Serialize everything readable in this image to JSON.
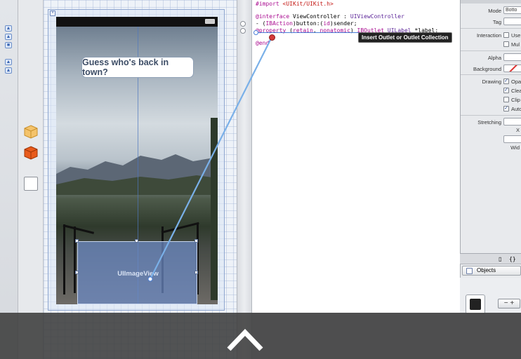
{
  "canvas": {
    "label_text": "Guess who's back in town?",
    "image_view_text": "UIImageView"
  },
  "code": {
    "lines": [
      {
        "text": "#import <UIKit/UIKit.h>"
      },
      {
        "text": "@interface ViewController : UIViewController"
      },
      {
        "text": "- (IBAction)button:(id)sender;"
      },
      {
        "text": "@property (retain, nonatomic) IBOutlet UILabel *label;"
      },
      {
        "text": "@end"
      }
    ],
    "tooltip": "Insert Outlet or Outlet Collection"
  },
  "inspector": {
    "mode_label": "Mode",
    "mode_value": "Botto",
    "tag_label": "Tag",
    "interaction_label": "Interaction",
    "interaction_opts": [
      "Use",
      "Mul"
    ],
    "alpha_label": "Alpha",
    "background_label": "Background",
    "drawing_label": "Drawing",
    "drawing_opts": [
      "Opa",
      "Clea",
      "Clip",
      "Auto"
    ],
    "stretching_label": "Stretching",
    "x_label": "X",
    "width_label": "Wid"
  },
  "library": {
    "selector_label": "Objects"
  },
  "colors": {
    "keyword": "#aa0d91",
    "string": "#c41a16",
    "accent": "#4a7fd8"
  }
}
